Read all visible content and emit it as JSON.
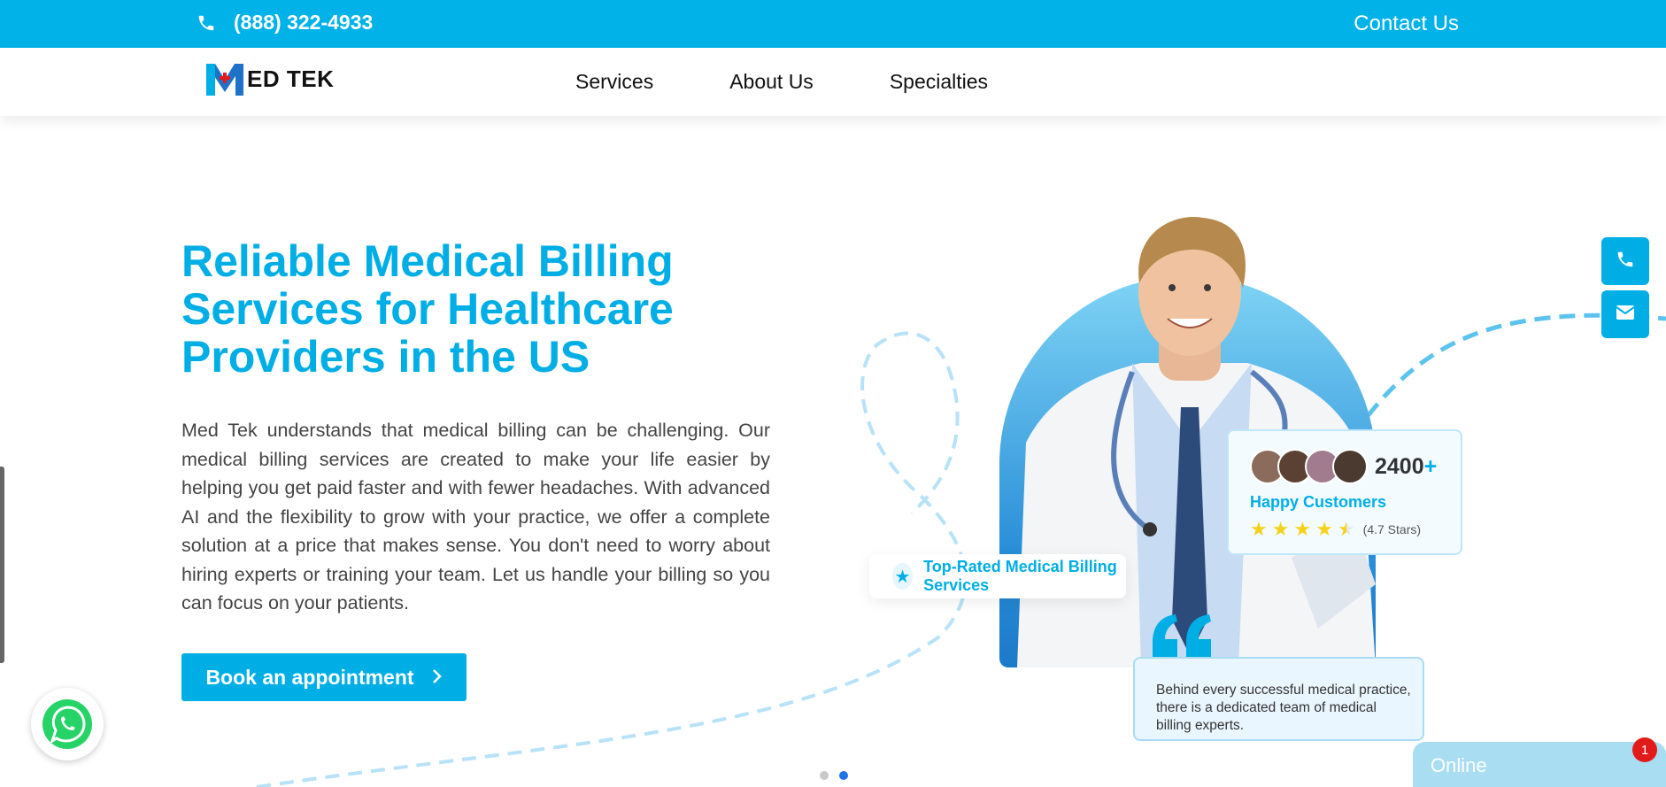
{
  "topbar": {
    "phone": "(888) 322-4933",
    "contact_label": "Contact Us",
    "icons": [
      "phone-icon"
    ]
  },
  "logo": {
    "text": "ED TEK",
    "mark_letter": "M"
  },
  "nav": {
    "items": [
      {
        "label": "Services"
      },
      {
        "label": "About Us"
      },
      {
        "label": "Specialties"
      }
    ]
  },
  "hero": {
    "title": "Reliable Medical Billing Services for Healthcare Providers in the US",
    "description": "Med Tek understands that medical billing can be challenging. Our medical billing services are created to make your life easier by helping you get paid faster and with fewer headaches. With advanced AI and the flexibility to grow with your practice, we offer a complete solution at a price that makes sense. You don't need to worry about hiring experts or training your team. Let us handle your billing so you can focus on your patients.",
    "cta_label": "Book an appointment"
  },
  "customers_card": {
    "count": "2400",
    "plus": "+",
    "label": "Happy Customers",
    "rating_text": "(4.7 Stars)",
    "rating": 4.5,
    "max_rating": 5
  },
  "top_rated": {
    "label": "Top-Rated Medical Billing Services"
  },
  "quote": {
    "text": "Behind every successful medical practice, there is a dedicated team of medical billing experts."
  },
  "carousel": {
    "slides": 2,
    "active_index": 1
  },
  "chat": {
    "status": "Online",
    "badge_count": "1"
  },
  "colors": {
    "brand": "#00aee6",
    "topbar": "#00b2e8",
    "star": "#f4d21b",
    "badge": "#e21a1a",
    "dot_active": "#1e73e8"
  }
}
